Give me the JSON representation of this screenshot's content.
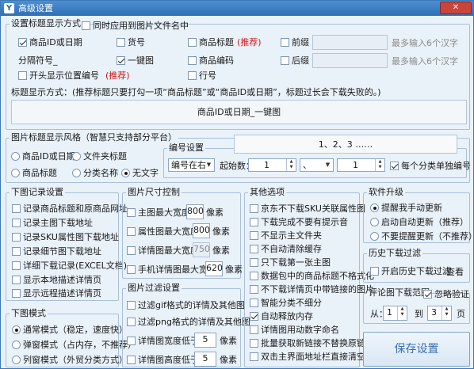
{
  "window": {
    "title": "高级设置",
    "close_label": "✕"
  },
  "naming": {
    "legend": "设置标题显示方式",
    "sync_filename": "同时应用到图片文件名中",
    "row1": {
      "product_id_date": "商品ID或日期",
      "item_no": "货号",
      "product_title": "商品标题",
      "recommend": "(推荐)",
      "prefix": "前缀",
      "hint1": "最多输入6个汉字"
    },
    "row2": {
      "separator_label": "分隔符号",
      "separator_value": "_",
      "one_key_download": "一键图",
      "product_code": "商品编码",
      "suffix": "后缀",
      "hint2": "最多输入6个汉字"
    },
    "row3": {
      "show_position_code": "开头显示位置编号",
      "recommend": "(推荐)",
      "row_no": "行号"
    },
    "format_note": "标题显示方式：(推荐标题只要打勾一项“商品标题”或“商品ID或日期”，标题过长会下载失败的。)",
    "preview": "商品ID或日期_一键图"
  },
  "image_title_style": {
    "legend": "图片标题显示风格（智慧只支持部分平台）",
    "options": {
      "product_id_date": "商品ID或日期",
      "folder_title": "文件夹标题",
      "product_title": "商品标题",
      "category_name": "分类名称",
      "no_text": "无文字"
    },
    "numbering": {
      "legend": "编号设置",
      "sample": "1、2、3 ……",
      "position_value": "编号在右",
      "start_label": "起始数：",
      "start_value": "1",
      "separator_value": "、",
      "step_value": "1",
      "per_category": "每个分类单独编号"
    }
  },
  "record_settings": {
    "legend": "下图记录设置",
    "items": [
      "记录商品标题和原商品网址",
      "记录主图下载地址",
      "记录SKU属性图下载地址",
      "记录细节图下载地址",
      "详细下载记录(EXCEL文档)",
      "显示本地描述详情页",
      "显示远程描述详情页"
    ]
  },
  "download_mode": {
    "legend": "下图模式",
    "options": [
      "通常模式（稳定，速度快）",
      "弹窗模式（占内存，不推荐）",
      "列窗模式（外贸分类方式）"
    ]
  },
  "size_control": {
    "legend": "图片尺寸控制",
    "rows": [
      {
        "label": "主图最大宽度：",
        "value": "800",
        "unit": "像素"
      },
      {
        "label": "属性图最大宽度：",
        "value": "800",
        "unit": "像素"
      },
      {
        "label": "详情图最大宽度：",
        "value": "750",
        "unit": "像素"
      },
      {
        "label": "手机详情图最大宽度：",
        "value": "620",
        "unit": "像素"
      }
    ]
  },
  "image_filter": {
    "legend": "图片过滤设置",
    "items": [
      "过滤gif格式的详情及其他图",
      "过滤png格式的详情及其他图"
    ],
    "rows": [
      {
        "label": "详情图宽度低于：",
        "value": "5",
        "unit": "像素"
      },
      {
        "label": "详情图高度低于：",
        "value": "5",
        "unit": "像素"
      }
    ]
  },
  "other_options": {
    "legend": "其他选项",
    "items": [
      "京东不下载SKU关联属性图",
      "下载完成不要有提示音",
      "不显示主文件夹",
      "不自动清除缓存",
      "只下载第一张主图",
      "数据包中的商品标题不格式化",
      "不下载详情页中带链接的图片",
      "智能分类不细分",
      "自动释放内存",
      "详情图用动数字命名",
      "批量获取新链接不替换原链接",
      "双击主界面地址栏直接清空"
    ]
  },
  "upgrade": {
    "legend": "软件升级",
    "options": [
      "提醒我手动更新",
      "启动自动更新（推荐）",
      "不要提醒更新（不推荐）"
    ]
  },
  "history_filter": {
    "legend": "历史下载过滤",
    "enable": "开启历史下载过滤",
    "view": "查看"
  },
  "comment_range": {
    "legend": "评论图下载范围",
    "ignore_verify": "忽略验证",
    "from_label": "从：",
    "from_value": "1",
    "to_label": "到",
    "to_value": "3",
    "page_label": "页"
  },
  "save_button": "保存设置"
}
